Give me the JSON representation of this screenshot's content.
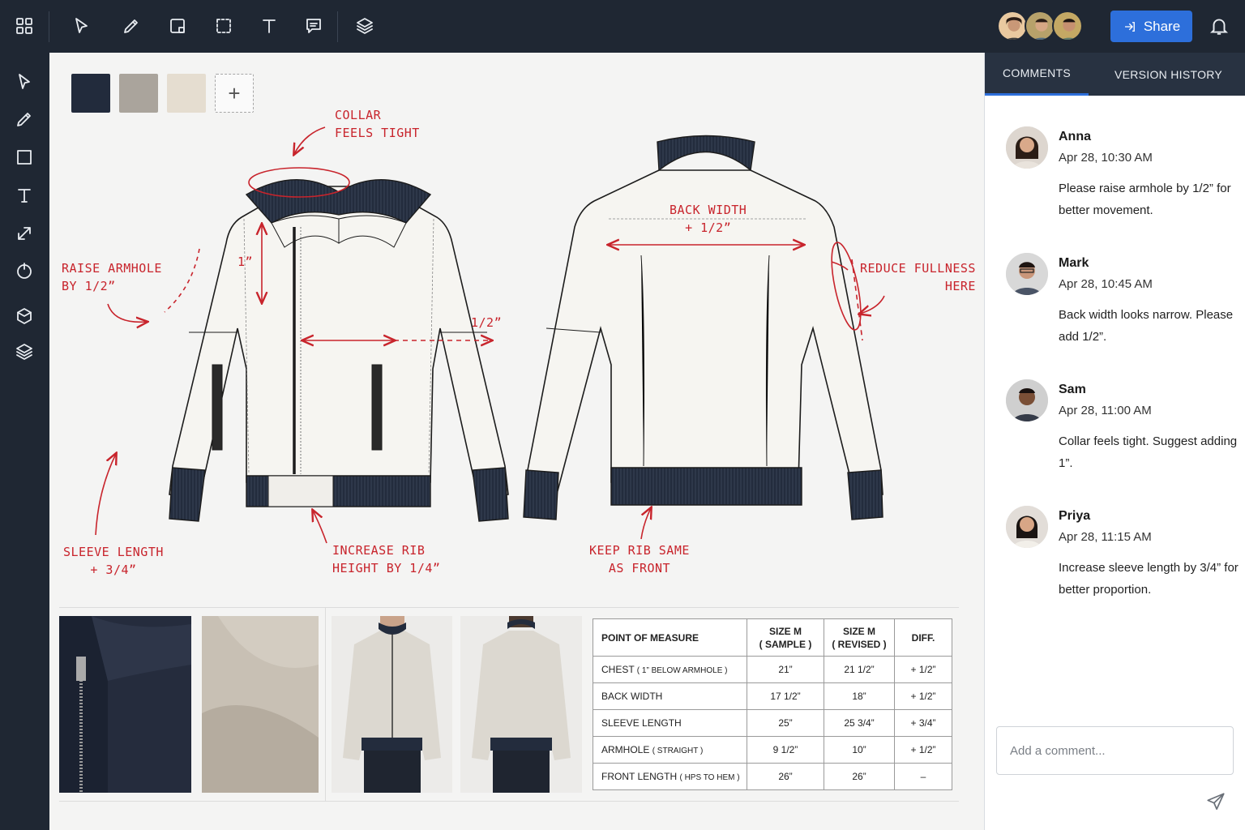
{
  "toolbar": {
    "icons": [
      "grid-icon",
      "select-cursor-icon",
      "pencil-icon",
      "frame-icon",
      "crop-icon",
      "text-icon",
      "comment-icon",
      "layers-icon"
    ],
    "share_label": "Share",
    "colors": {
      "bar": "#1f2733",
      "accent": "#2d6fdb"
    }
  },
  "leftbar": {
    "icons": [
      "pointer-icon",
      "pencil-icon",
      "rectangle-icon",
      "text-icon",
      "resize-arrow-icon",
      "power-icon",
      "cube-icon",
      "layers-icon"
    ]
  },
  "swatches": {
    "colors": [
      "#222b3c",
      "#aaa49c",
      "#e5ddd0"
    ],
    "add_label": "+"
  },
  "annotations": {
    "collar": "COLLAR\nFEELS TIGHT",
    "armhole": "RAISE ARMHOLE\nBY 1/2”",
    "one_inch": "1”",
    "half_inch": "1/2”",
    "sleeve": "SLEEVE LENGTH\n+ 3/4”",
    "rib": "INCREASE RIB\nHEIGHT BY 1/4”",
    "back_width": "BACK WIDTH\n+ 1/2”",
    "fullness": "REDUCE FULLNESS\nHERE",
    "keep_rib": "KEEP RIB SAME\nAS FRONT"
  },
  "measurements": {
    "headers": [
      "POINT OF MEASURE",
      "SIZE M\n( SAMPLE )",
      "SIZE M\n( REVISED )",
      "DIFF."
    ],
    "rows": [
      {
        "pom": "CHEST",
        "pom_note": "( 1” BELOW ARMHOLE )",
        "sample": "21”",
        "revised": "21 1/2”",
        "diff": "+ 1/2”"
      },
      {
        "pom": "BACK WIDTH",
        "pom_note": "",
        "sample": "17 1/2”",
        "revised": "18”",
        "diff": "+ 1/2”"
      },
      {
        "pom": "SLEEVE LENGTH",
        "pom_note": "",
        "sample": "25”",
        "revised": "25 3/4”",
        "diff": "+ 3/4”"
      },
      {
        "pom": "ARMHOLE",
        "pom_note": "( STRAIGHT )",
        "sample": "9 1/2”",
        "revised": "10”",
        "diff": "+ 1/2”"
      },
      {
        "pom": "FRONT LENGTH",
        "pom_note": "( HPS TO HEM )",
        "sample": "26”",
        "revised": "26”",
        "diff": "–"
      }
    ]
  },
  "panel": {
    "tabs": [
      {
        "label": "COMMENTS",
        "active": true
      },
      {
        "label": "VERSION HISTORY",
        "active": false
      }
    ],
    "comments": [
      {
        "name": "Anna",
        "date": "Apr 28, 10:30 AM",
        "text": "Please raise armhole by 1/2” for better movement."
      },
      {
        "name": "Mark",
        "date": "Apr 28, 10:45 AM",
        "text": "Back width looks narrow. Please add 1/2”."
      },
      {
        "name": "Sam",
        "date": "Apr 28, 11:00 AM",
        "text": "Collar feels tight. Suggest adding 1”."
      },
      {
        "name": "Priya",
        "date": "Apr 28, 11:15 AM",
        "text": "Increase sleeve length by 3/4” for better proportion."
      }
    ],
    "input_placeholder": "Add a comment..."
  }
}
